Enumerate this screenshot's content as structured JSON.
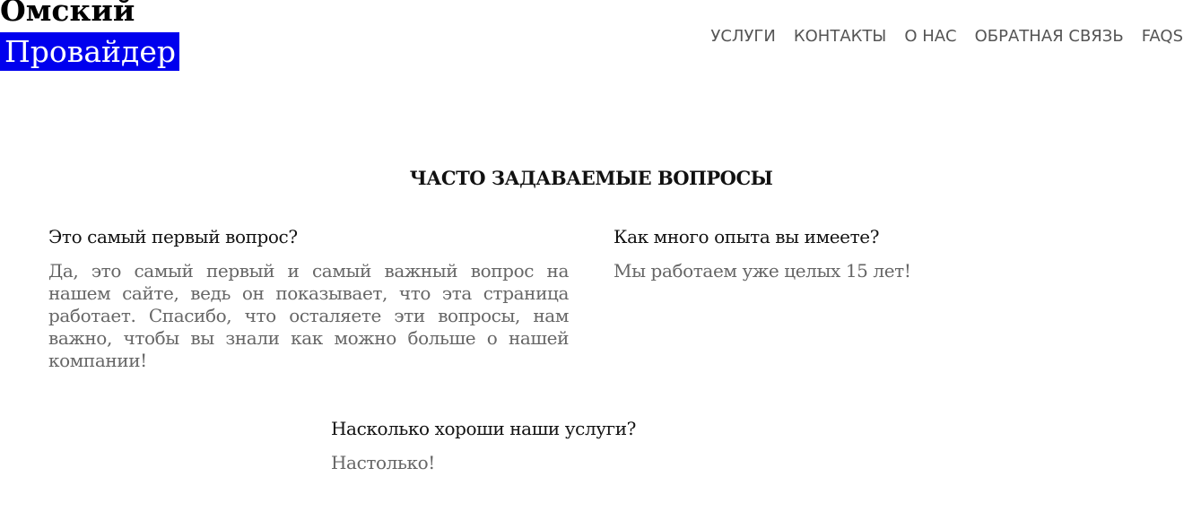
{
  "logo": {
    "line1": "Омский",
    "line2": "Провайдер",
    "highlight_color": "#0000ee"
  },
  "nav": {
    "items": [
      "УСЛУГИ",
      "КОНТАКТЫ",
      "О НАС",
      "ОБРАТНАЯ СВЯЗЬ",
      "FAQS"
    ]
  },
  "faq": {
    "title": "ЧАСТО ЗАДАВАЕМЫЕ ВОПРОСЫ",
    "items": [
      {
        "question": "Это самый первый вопрос?",
        "answer": "Да, это самый первый и самый важный вопрос на нашем сайте, ведь он показывает, что эта страница работает. Спасибо, что осталяете эти вопросы, нам важно, чтобы вы знали как можно больше о нашей компании!"
      },
      {
        "question": "Как много опыта вы имеете?",
        "answer": "Мы работаем уже целых 15 лет!"
      },
      {
        "question": "Насколько хороши наши услуги?",
        "answer": "Настолько!"
      }
    ]
  }
}
